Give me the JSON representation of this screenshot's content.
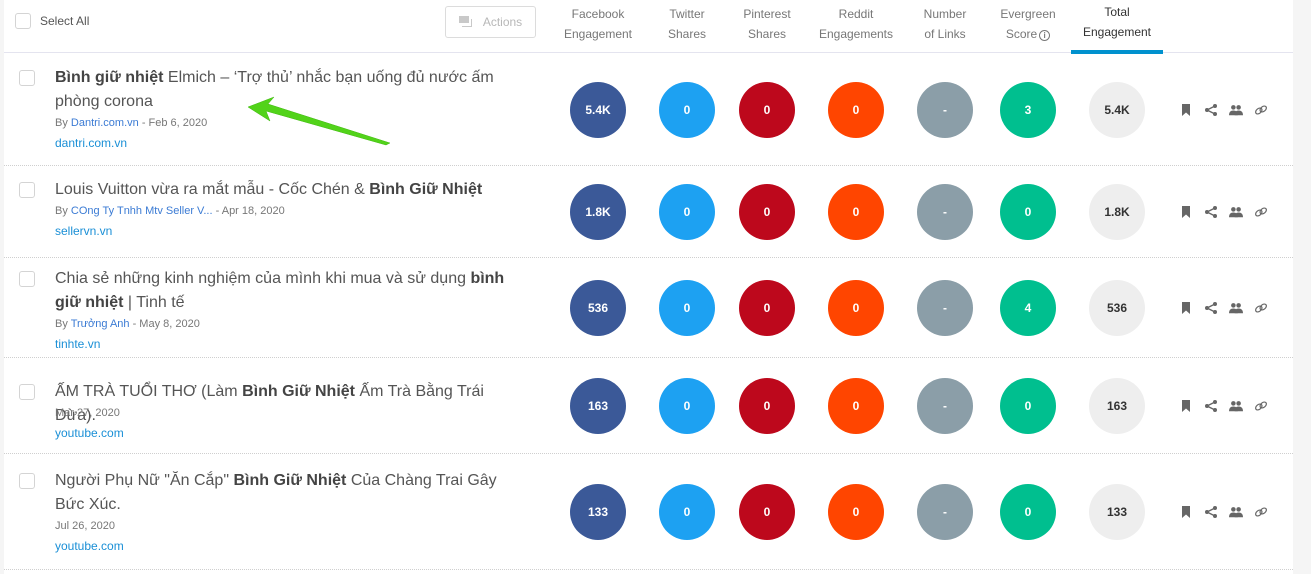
{
  "header": {
    "select_all_label": "Select All",
    "actions_label": "Actions",
    "columns": [
      {
        "line1": "Facebook",
        "line2": "Engagement"
      },
      {
        "line1": "Twitter",
        "line2": "Shares"
      },
      {
        "line1": "Pinterest",
        "line2": "Shares"
      },
      {
        "line1": "Reddit",
        "line2": "Engagements"
      },
      {
        "line1": "Number",
        "line2": "of Links"
      },
      {
        "line1": "Evergreen",
        "line2": "Score"
      },
      {
        "line1": "Total",
        "line2": "Engagement"
      }
    ],
    "info_glyph": "i",
    "active_column": "Total Engagement"
  },
  "colors": {
    "facebook": "#3b5998",
    "twitter": "#1da1f2",
    "pinterest": "#bd081c",
    "reddit": "#ff4500",
    "links": "#8b9ea8",
    "evergreen": "#00bf8f",
    "total": "#eeeeee",
    "accent": "#0091ce",
    "link_text": "#1a8fd6",
    "annotation_arrow": "#52d31a"
  },
  "rows": [
    {
      "title_bold": "Bình giữ nhiệt",
      "title_rest": " Elmich – ‘Trợ thủ’ nhắc bạn uống đủ nước ấm phòng corona",
      "by_prefix": "By ",
      "author": "Dantri.com.vn",
      "date": " - Feb 6, 2020",
      "domain": "dantri.com.vn",
      "facebook": "5.4K",
      "twitter": "0",
      "pinterest": "0",
      "reddit": "0",
      "links": "-",
      "evergreen": "3",
      "total": "5.4K"
    },
    {
      "title_pre": "Louis Vuitton vừa ra mắt mẫu - Cốc Chén & ",
      "title_bold": "Bình Giữ Nhiệt",
      "by_prefix": "By ",
      "author": "COng Ty Tnhh Mtv Seller V...",
      "date": " - Apr 18, 2020",
      "domain": "sellervn.vn",
      "facebook": "1.8K",
      "twitter": "0",
      "pinterest": "0",
      "reddit": "0",
      "links": "-",
      "evergreen": "0",
      "total": "1.8K"
    },
    {
      "title_pre": "Chia sẻ những kinh nghiệm của mình khi mua và sử dụng ",
      "title_bold": "bình giữ nhiệt",
      "title_rest": " | Tinh tế",
      "by_prefix": "By ",
      "author": "Trưởng Anh",
      "date": " - May 8, 2020",
      "domain": "tinhte.vn",
      "facebook": "536",
      "twitter": "0",
      "pinterest": "0",
      "reddit": "0",
      "links": "-",
      "evergreen": "4",
      "total": "536"
    },
    {
      "title_pre": "ẤM TRÀ TUỔI THƠ (Làm ",
      "title_bold": "Bình Giữ Nhiệt",
      "title_rest": " Ấm Trà Bằng Trái Dừa).",
      "date_only": "Mar 27, 2020",
      "domain": "youtube.com",
      "facebook": "163",
      "twitter": "0",
      "pinterest": "0",
      "reddit": "0",
      "links": "-",
      "evergreen": "0",
      "total": "163"
    },
    {
      "title_pre": "Người Phụ Nữ \"Ăn Cắp\" ",
      "title_bold": "Bình Giữ Nhiệt",
      "title_rest": " Của Chàng Trai Gây Bức Xúc.",
      "date_only": "Jul 26, 2020",
      "domain": "youtube.com",
      "facebook": "133",
      "twitter": "0",
      "pinterest": "0",
      "reddit": "0",
      "links": "-",
      "evergreen": "0",
      "total": "133"
    }
  ],
  "row_icons": [
    "bookmark-icon",
    "share-icon",
    "users-icon",
    "link-icon"
  ]
}
